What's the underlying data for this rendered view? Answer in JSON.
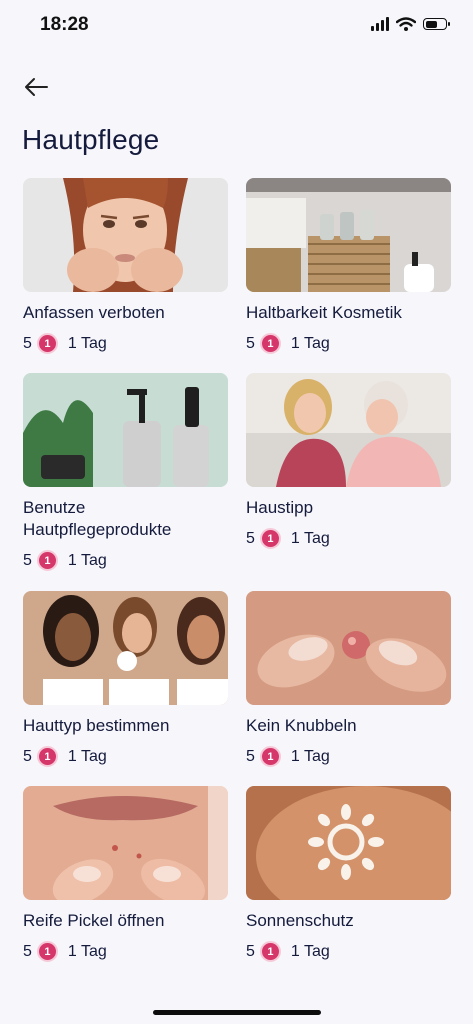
{
  "status_bar": {
    "time": "18:28"
  },
  "header": {
    "title": "Hautpflege"
  },
  "cards": [
    {
      "title": "Anfassen verboten",
      "points": "5",
      "coin_icon": "1",
      "duration": "1 Tag"
    },
    {
      "title": "Haltbarkeit Kosmetik",
      "points": "5",
      "coin_icon": "1",
      "duration": "1 Tag"
    },
    {
      "title": "Benutze Hautpflegeprodukte",
      "points": "5",
      "coin_icon": "1",
      "duration": "1 Tag"
    },
    {
      "title": "Haustipp",
      "points": "5",
      "coin_icon": "1",
      "duration": "1 Tag"
    },
    {
      "title": "Hauttyp bestimmen",
      "points": "5",
      "coin_icon": "1",
      "duration": "1 Tag"
    },
    {
      "title": "Kein Knubbeln",
      "points": "5",
      "coin_icon": "1",
      "duration": "1 Tag"
    },
    {
      "title": "Reife Pickel öffnen",
      "points": "5",
      "coin_icon": "1",
      "duration": "1 Tag"
    },
    {
      "title": "Sonnenschutz",
      "points": "5",
      "coin_icon": "1",
      "duration": "1 Tag"
    }
  ],
  "colors": {
    "accent": "#d6376a",
    "text": "#141b3c",
    "background": "#f7f6fb"
  }
}
